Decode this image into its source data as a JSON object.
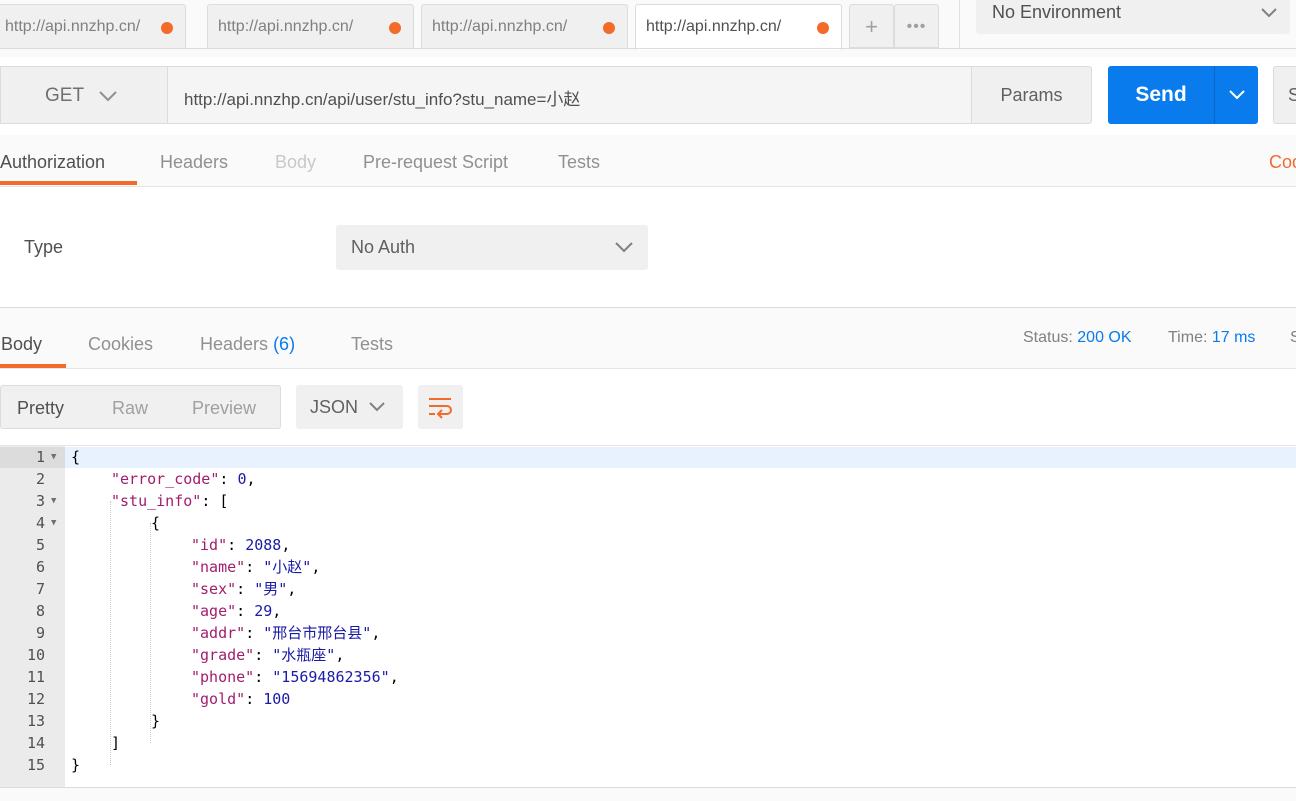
{
  "tabs": [
    {
      "label": "http://api.nnzhp.cn/"
    },
    {
      "label": "http://api.nnzhp.cn/"
    },
    {
      "label": "http://api.nnzhp.cn/"
    },
    {
      "label": "http://api.nnzhp.cn/"
    }
  ],
  "tab_actions": {
    "new": "+",
    "more": "•••"
  },
  "environment": {
    "selected": "No Environment"
  },
  "request": {
    "method": "GET",
    "url": "http://api.nnzhp.cn/api/user/stu_info?stu_name=小赵",
    "params_label": "Params",
    "send_label": "Send",
    "save_label": "S"
  },
  "request_tabs": {
    "authorization": "Authorization",
    "headers": "Headers",
    "body": "Body",
    "prerequest": "Pre-request Script",
    "tests": "Tests",
    "code": "Cod"
  },
  "auth": {
    "type_label": "Type",
    "type_value": "No Auth"
  },
  "response_tabs": {
    "body": "Body",
    "cookies": "Cookies",
    "headers": "Headers",
    "headers_count": "(6)",
    "tests": "Tests"
  },
  "response_status": {
    "status_label": "Status:",
    "status_value": "200 OK",
    "time_label": "Time:",
    "time_value": "17 ms",
    "size_label": "S"
  },
  "view": {
    "pretty": "Pretty",
    "raw": "Raw",
    "preview": "Preview",
    "format": "JSON"
  },
  "code_lines": [
    {
      "num": "1",
      "text": "{"
    },
    {
      "num": "2",
      "text": "\"error_code\": 0,"
    },
    {
      "num": "3",
      "text": "\"stu_info\": ["
    },
    {
      "num": "4",
      "text": "{"
    },
    {
      "num": "5",
      "text": "\"id\": 2088,"
    },
    {
      "num": "6",
      "text": "\"name\": \"小赵\","
    },
    {
      "num": "7",
      "text": "\"sex\": \"男\","
    },
    {
      "num": "8",
      "text": "\"age\": 29,"
    },
    {
      "num": "9",
      "text": "\"addr\": \"邢台市邢台县\","
    },
    {
      "num": "10",
      "text": "\"grade\": \"水瓶座\","
    },
    {
      "num": "11",
      "text": "\"phone\": \"15694862356\","
    },
    {
      "num": "12",
      "text": "\"gold\": 100"
    },
    {
      "num": "13",
      "text": "}"
    },
    {
      "num": "14",
      "text": "]"
    },
    {
      "num": "15",
      "text": "}"
    }
  ],
  "colors": {
    "accent": "#f26b2a",
    "primary": "#097bed",
    "json_key": "#a11d6d",
    "json_value": "#1a1aa6"
  }
}
